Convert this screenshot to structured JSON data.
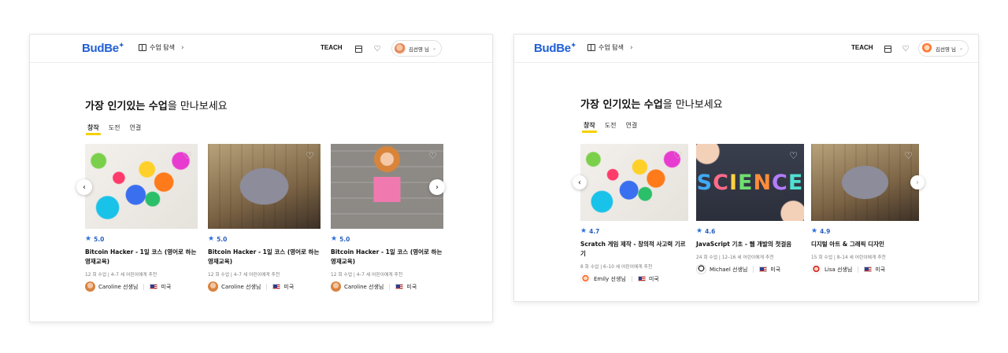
{
  "panels": [
    {
      "nav": {
        "logo": "BudBe",
        "explore": "수업 탐색",
        "teach": "TEACH",
        "user": "김선영 님"
      },
      "heading_strong": "가장 인기있는 수업",
      "heading_rest": "을 만나보세요",
      "tabs": [
        "창작",
        "도전",
        "연결"
      ],
      "active_tab": "창작",
      "cards": [
        {
          "rating": "5.0",
          "title": "Bitcoin Hacker - 1일 코스 (영어로 하는 영재교육)",
          "meta": "12 회 수업 | 4–7 세 어린이에게 추천",
          "teacher": "Caroline 선생님",
          "country": "미국"
        },
        {
          "rating": "5.0",
          "title": "Bitcoin Hacker - 1일 코스 (영어로 하는 영재교육)",
          "meta": "12 회 수업 | 4–7 세 어린이에게 추천",
          "teacher": "Caroline 선생님",
          "country": "미국"
        },
        {
          "rating": "5.0",
          "title": "Bitcoin Hacker - 1일 코스 (영어로 하는 영재교육)",
          "meta": "12 회 수업 | 4–7 세 어린이에게 추천",
          "teacher": "Caroline 선생님",
          "country": "미국"
        }
      ]
    },
    {
      "nav": {
        "logo": "BudBe",
        "explore": "수업 탐색",
        "teach": "TEACH",
        "user": "김선영 님"
      },
      "heading_strong": "가장 인기있는 수업",
      "heading_rest": "을 만나보세요",
      "tabs": [
        "창작",
        "도전",
        "연결"
      ],
      "active_tab": "창작",
      "science_word": "SCIENCE",
      "cards": [
        {
          "rating": "4.7",
          "title": "Scratch 게임 제작 - 창의적 사고력 기르기",
          "meta": "8 회 수업 | 6–10 세 어린이에게 추천",
          "teacher": "Emily 선생님",
          "country": "미국"
        },
        {
          "rating": "4.6",
          "title": "JavaScript 기초 - 웹 개발의 첫걸음",
          "meta": "24 회 수업 | 12–16 세 어린이에게 추천",
          "teacher": "Michael 선생님",
          "country": "미국"
        },
        {
          "rating": "4.9",
          "title": "디지털 아트 & 그래픽 디자인",
          "meta": "15 회 수업 | 8–14 세 어린이에게 추천",
          "teacher": "Lisa 선생님",
          "country": "미국"
        }
      ]
    }
  ],
  "icons": {
    "star": "★",
    "heart": "♡",
    "prev": "‹",
    "next": "›",
    "chevron": "›"
  },
  "colors": {
    "brand": "#1f5fd6",
    "rating": "#2a5fbf",
    "tab_underline": "#f5d000"
  }
}
